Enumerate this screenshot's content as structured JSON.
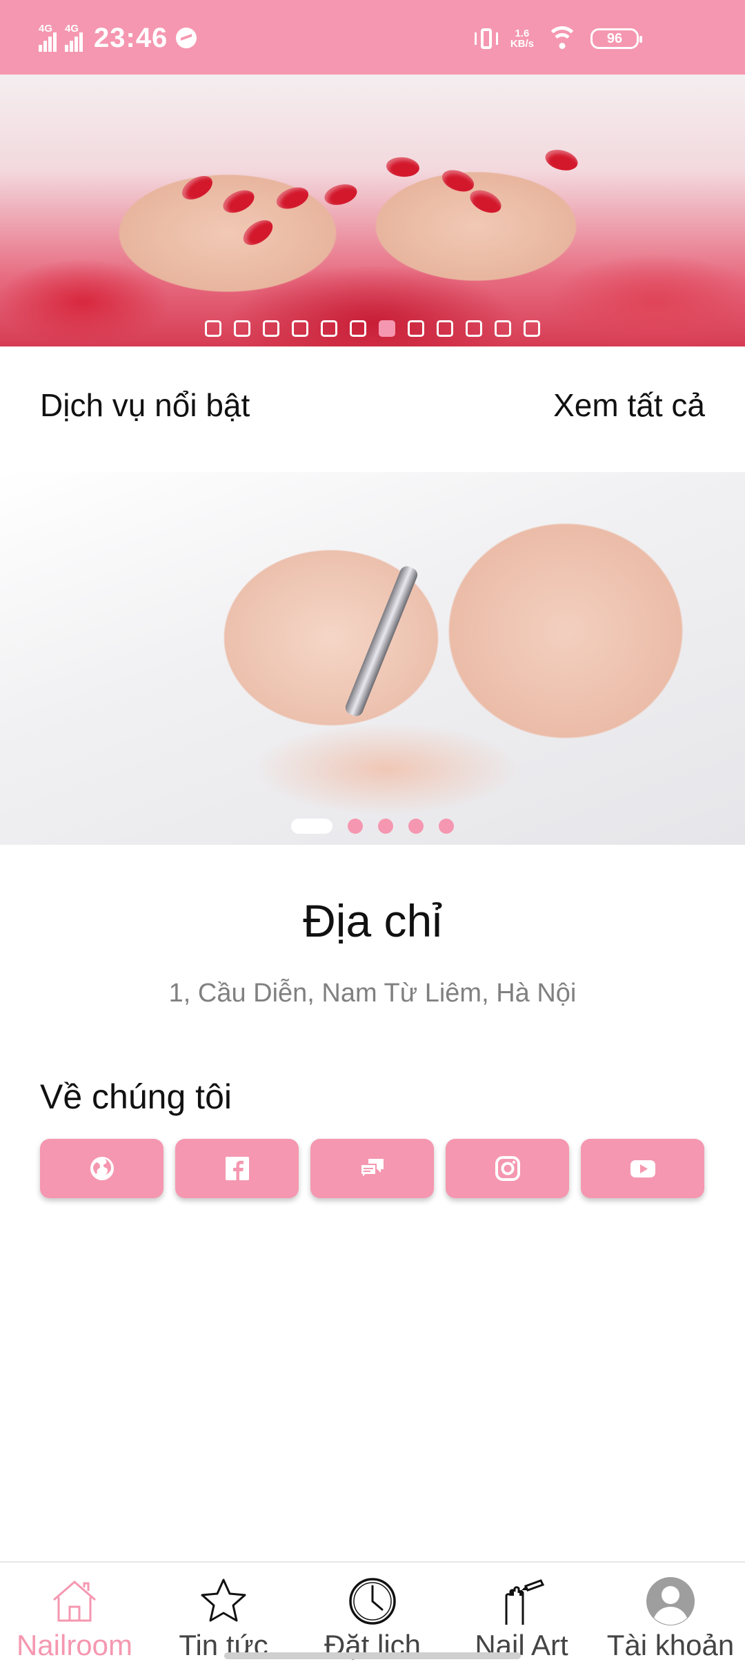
{
  "status_bar": {
    "network_left": "4G",
    "network_right": "4G",
    "time": "23:46",
    "speed_value": "1.6",
    "speed_unit": "KB/s",
    "battery": "96",
    "icons": [
      "signal-icon",
      "messenger-icon",
      "vibrate-icon",
      "wifi-icon",
      "battery-icon"
    ]
  },
  "hero": {
    "slide_count": 12,
    "active_index": 6
  },
  "featured": {
    "title": "Dịch vụ nổi bật",
    "view_all": "Xem tất cả",
    "slide_count": 5,
    "active_index": 0
  },
  "address": {
    "title": "Địa chỉ",
    "value": "1, Cầu Diễn, Nam Từ Liêm, Hà Nội"
  },
  "about": {
    "title": "Về chúng tôi",
    "buttons": [
      {
        "icon": "globe-icon"
      },
      {
        "icon": "facebook-icon"
      },
      {
        "icon": "chat-icon"
      },
      {
        "icon": "instagram-icon"
      },
      {
        "icon": "youtube-icon"
      }
    ]
  },
  "bottom_nav": {
    "items": [
      {
        "label": "Nailroom",
        "icon": "home-icon",
        "active": true
      },
      {
        "label": "Tin tức",
        "icon": "star-icon",
        "active": false
      },
      {
        "label": "Đặt lịch",
        "icon": "clock-icon",
        "active": false
      },
      {
        "label": "Nail Art",
        "icon": "nail-art-icon",
        "active": false
      },
      {
        "label": "Tài khoản",
        "icon": "account-icon",
        "active": false
      }
    ]
  },
  "colors": {
    "accent": "#f597b0",
    "text": "#111111",
    "muted": "#808080"
  }
}
